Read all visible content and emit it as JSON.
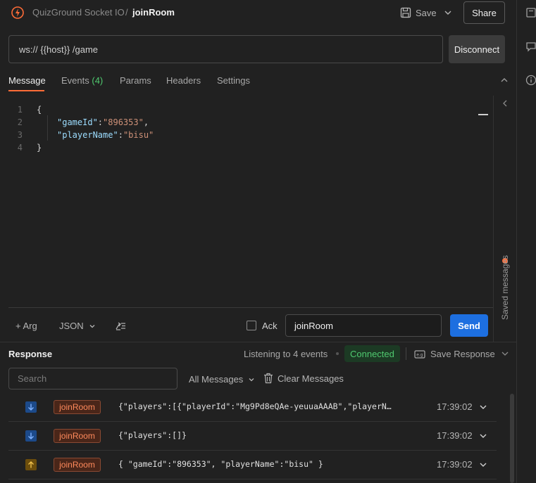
{
  "header": {
    "collection": "QuizGround Socket IO",
    "separator": "/",
    "request_name": "joinRoom",
    "save_label": "Save",
    "share_label": "Share"
  },
  "url": {
    "value": "ws:// {{host}} /game",
    "connect_label": "Disconnect"
  },
  "tabs": [
    {
      "label": "Message"
    },
    {
      "label": "Events",
      "count": "(4)"
    },
    {
      "label": "Params"
    },
    {
      "label": "Headers"
    },
    {
      "label": "Settings"
    }
  ],
  "editor": {
    "line_numbers": [
      "1",
      "2",
      "3",
      "4"
    ],
    "brace_open": "{",
    "brace_close": "}",
    "line2_key": "\"gameId\"",
    "line2_colon": ":",
    "line2_value": "\"896353\"",
    "line2_comma": ",",
    "line3_key": "\"playerName\"",
    "line3_colon": ":",
    "line3_value": "\"bisu\""
  },
  "saved_messages_label": "Saved messages",
  "compose": {
    "arg_label": "+ Arg",
    "format_label": "JSON",
    "ack_label": "Ack",
    "event_name": "joinRoom",
    "send_label": "Send"
  },
  "response": {
    "title": "Response",
    "listening": "Listening to 4 events",
    "status": "Connected",
    "save_response_label": "Save Response",
    "search_placeholder": "Search",
    "filter_label": "All Messages",
    "clear_label": "Clear Messages",
    "messages": [
      {
        "direction": "incoming",
        "event": "joinRoom",
        "body": "{\"players\":[{\"playerId\":\"Mg9Pd8eQAe-yeuuaAAAB\",\"playerN…",
        "time": "17:39:02"
      },
      {
        "direction": "incoming",
        "event": "joinRoom",
        "body": "{\"players\":[]}",
        "time": "17:39:02"
      },
      {
        "direction": "outgoing",
        "event": "joinRoom",
        "body": "{ \"gameId\":\"896353\", \"playerName\":\"bisu\" }",
        "time": "17:39:02"
      }
    ]
  },
  "colors": {
    "accent": "#ff6c37",
    "send": "#1d6fe0",
    "connected": "#4fc96f"
  }
}
